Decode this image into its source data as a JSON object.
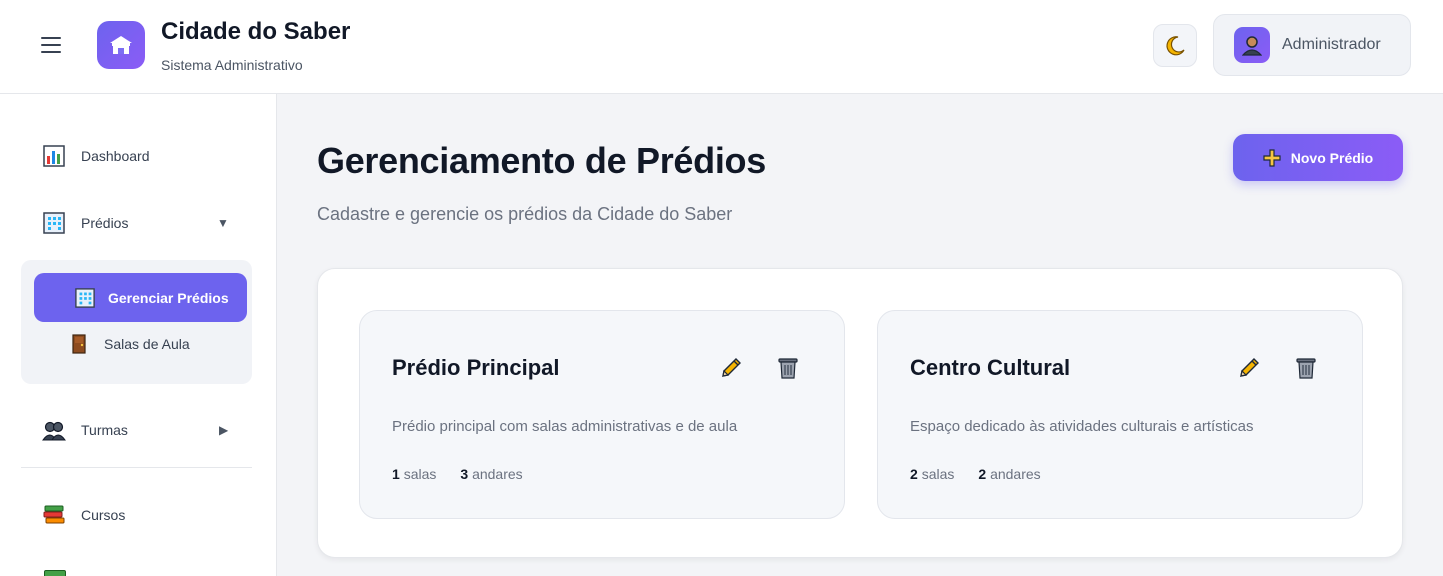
{
  "header": {
    "app_title": "Cidade do Saber",
    "app_subtitle": "Sistema Administrativo",
    "user_name": "Administrador",
    "icons": {
      "menu": "hamburger-icon",
      "logo": "building-icon",
      "theme": "moon-icon",
      "avatar": "user-icon"
    }
  },
  "sidebar": {
    "items": [
      {
        "label": "Dashboard",
        "icon": "chart-icon"
      },
      {
        "label": "Prédios",
        "icon": "building-icon",
        "expanded": true
      },
      {
        "label": "Turmas",
        "icon": "people-icon",
        "expanded": false
      },
      {
        "label": "Cursos",
        "icon": "books-icon"
      }
    ],
    "submenu": [
      {
        "label": "Gerenciar Prédios",
        "icon": "building-icon",
        "active": true
      },
      {
        "label": "Salas de Aula",
        "icon": "door-icon",
        "active": false
      }
    ]
  },
  "main": {
    "title": "Gerenciamento de Prédios",
    "subtitle": "Cadastre e gerencie os prédios da Cidade do Saber",
    "new_button": "Novo Prédio",
    "buildings": [
      {
        "name": "Prédio Principal",
        "description": "Prédio principal com salas administrativas e de aula",
        "rooms": "1",
        "rooms_label": "salas",
        "floors": "3",
        "floors_label": "andares"
      },
      {
        "name": "Centro Cultural",
        "description": "Espaço dedicado às atividades culturais e artísticas",
        "rooms": "2",
        "rooms_label": "salas",
        "floors": "2",
        "floors_label": "andares"
      }
    ]
  },
  "colors": {
    "accent": "#6d63ee",
    "accent2": "#8b5cf6",
    "background": "#f3f4f7"
  }
}
